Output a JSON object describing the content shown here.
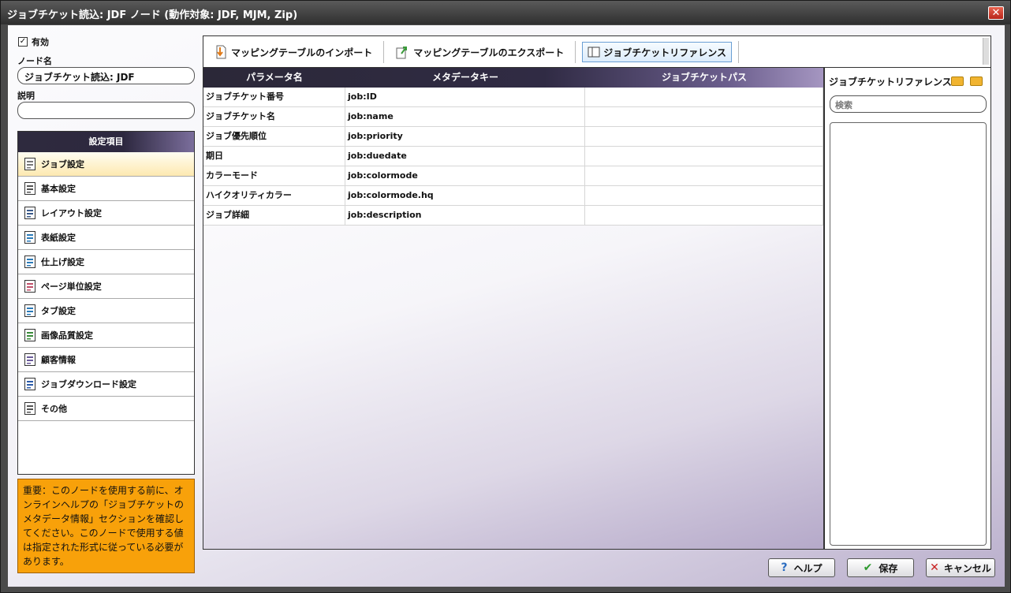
{
  "window": {
    "title": "ジョブチケット読込: JDF ノード (動作対象: JDF, MJM, Zip)",
    "close_glyph": "✕"
  },
  "enabled": {
    "checked_glyph": "✓",
    "label": "有効"
  },
  "node_name": {
    "label": "ノード名",
    "value": "ジョブチケット読込: JDF"
  },
  "description": {
    "label": "説明",
    "value": ""
  },
  "settings": {
    "header": "設定項目",
    "items": [
      {
        "label": "ジョブ設定",
        "icon": "document-icon",
        "selected": true
      },
      {
        "label": "基本設定",
        "icon": "list-icon"
      },
      {
        "label": "レイアウト設定",
        "icon": "layout-icon"
      },
      {
        "label": "表紙設定",
        "icon": "cover-icon"
      },
      {
        "label": "仕上げ設定",
        "icon": "finishing-icon"
      },
      {
        "label": "ページ単位設定",
        "icon": "pages-icon"
      },
      {
        "label": "タブ設定",
        "icon": "tab-icon"
      },
      {
        "label": "画像品質設定",
        "icon": "image-icon"
      },
      {
        "label": "顧客情報",
        "icon": "customer-icon"
      },
      {
        "label": "ジョブダウンロード設定",
        "icon": "download-icon"
      },
      {
        "label": "その他",
        "icon": "other-icon"
      }
    ]
  },
  "warning": {
    "text": "重要：このノードを使用する前に、オンラインヘルプの「ジョブチケットのメタデータ情報」セクションを確認してください。このノードで使用する値は指定された形式に従っている必要があります。"
  },
  "toolbar": {
    "import_label": "マッピングテーブルのインポート",
    "export_label": "マッピングテーブルのエクスポート",
    "reference_label": "ジョブチケットリファレンス"
  },
  "grid": {
    "columns": [
      "パラメータ名",
      "メタデータキー",
      "ジョブチケットパス"
    ],
    "rows": [
      [
        "ジョブチケット番号",
        "job:ID",
        ""
      ],
      [
        "ジョブチケット名",
        "job:name",
        ""
      ],
      [
        "ジョブ優先順位",
        "job:priority",
        ""
      ],
      [
        "期日",
        "job:duedate",
        ""
      ],
      [
        "カラーモード",
        "job:colormode",
        ""
      ],
      [
        "ハイクオリティカラー",
        "job:colormode.hq",
        ""
      ],
      [
        "ジョブ詳細",
        "job:description",
        ""
      ]
    ]
  },
  "reference_panel": {
    "title": "ジョブチケットリファレンス",
    "search_placeholder": "検索"
  },
  "buttons": {
    "help": "ヘルプ",
    "save": "保存",
    "cancel": "キャンセル"
  },
  "colors": {
    "accent_orange": "#f8a10a",
    "header_dark": "#2e2a3e",
    "header_light": "#7b6e9c"
  }
}
